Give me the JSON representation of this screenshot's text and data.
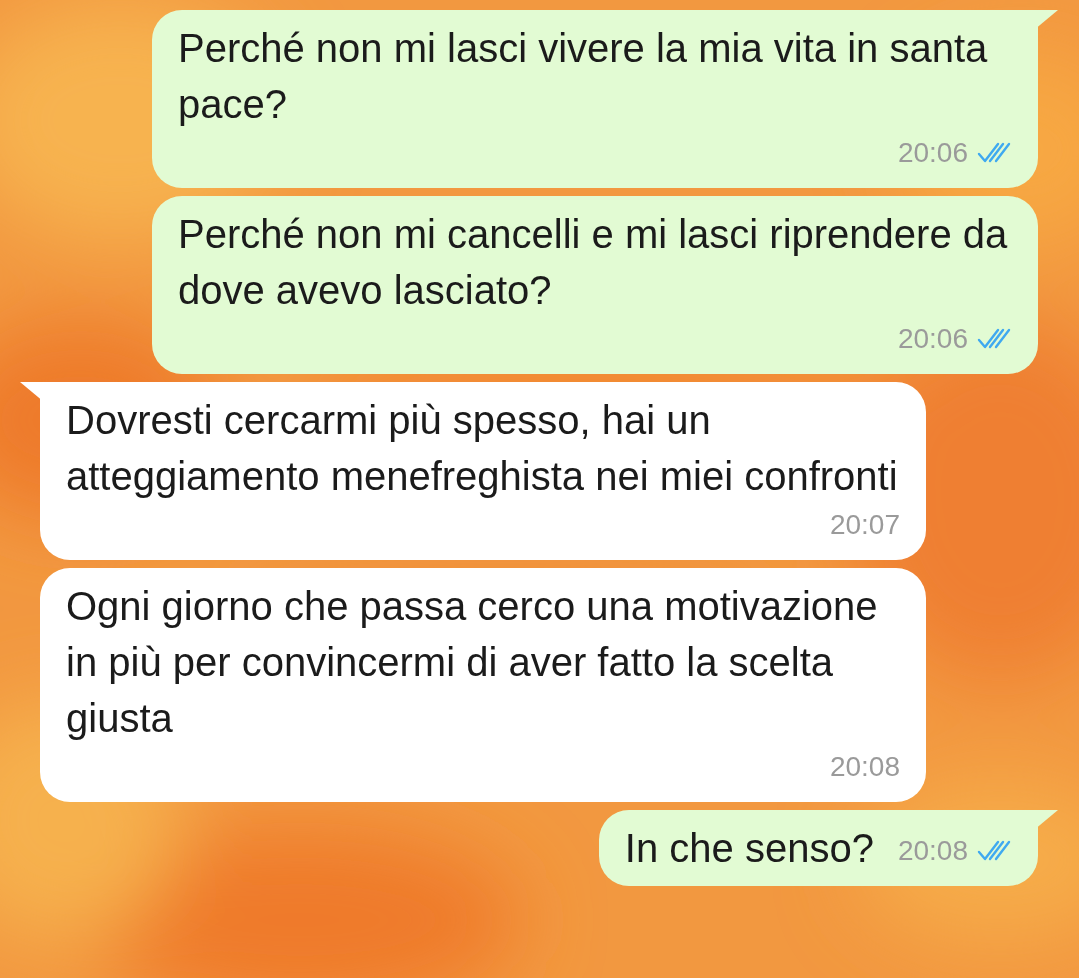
{
  "messages": [
    {
      "kind": "outgoing",
      "text": "Perché non mi lasci vivere la mia vita in santa pace?",
      "time": "20:06",
      "read": true
    },
    {
      "kind": "outgoing",
      "text": "Perché non mi cancelli e mi lasci riprendere da dove avevo lasciato?",
      "time": "20:06",
      "read": true
    },
    {
      "kind": "incoming",
      "text": "Dovresti cercarmi più spesso, hai un atteggiamento menefreghista nei miei confronti",
      "time": "20:07"
    },
    {
      "kind": "incoming",
      "text": "Ogni giorno che passa cerco una motivazione in più per convincermi di aver fatto la scelta giusta",
      "time": "20:08"
    },
    {
      "kind": "outgoing",
      "text": "In che senso?",
      "time": "20:08",
      "read": true
    }
  ]
}
